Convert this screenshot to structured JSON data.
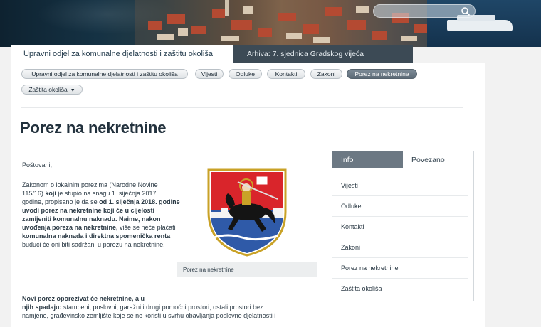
{
  "search": {
    "placeholder": ""
  },
  "header": {
    "title": "Upravni odjel za komunalne djelatnosti i zaštitu okoliša",
    "archive": "Arhiva: 7. sjednica Gradskog vijeća"
  },
  "nav": {
    "tabs": [
      {
        "label": "Upravni odjel za komunalne djelatnosti i zaštitu okoliša",
        "active": false
      },
      {
        "label": "Vijesti",
        "active": false
      },
      {
        "label": "Odluke",
        "active": false
      },
      {
        "label": "Kontakti",
        "active": false
      },
      {
        "label": "Zakoni",
        "active": false
      },
      {
        "label": "Porez na nekretnine",
        "active": true
      }
    ],
    "dropdown": {
      "label": "Zaštita okoliša",
      "caret": "▼"
    }
  },
  "page": {
    "title": "Porez na nekretnine",
    "greeting": "Poštovani,",
    "p1_a": "Zakonom o lokalnim porezima (Narodne Novine 115/16)",
    "p1_b": " koji",
    "p1_c": " je stupio na snagu 1. siječnja 2017. godine, propisano je da se ",
    "p1_d": "od 1. siječnja 2018. godine uvodi porez na nekretnine koji će u cijelosti zamijeniti komunalnu naknadu. Naime, nakon uvođenja poreza na nekretnine,",
    "p1_e": " više se neće plaćati ",
    "p1_f": "komunalna naknada i direktna spomenička renta",
    "p1_g": " budući će oni biti sadržani u porezu na nekretnine.",
    "p2_line1": "Novi porez oporezivat će nekretnine, a u",
    "p2_line2_bold": "njih spadaju:",
    "p2_line2_rest": " stambeni, poslovni, garažni i drugi pomoćni prostori, ostali prostori bez",
    "p2_line3": "namjene, građevinsko zemljište koje se ne koristi u svrhu obavljanja poslovne djelatnosti i",
    "image_caption": "Porez na nekretnine"
  },
  "sidebar": {
    "tabs": [
      {
        "label": "Info",
        "active": true
      },
      {
        "label": "Povezano",
        "active": false
      }
    ],
    "items": [
      "Vijesti",
      "Odluke",
      "Kontakti",
      "Zakoni",
      "Porez na nekretnine",
      "Zaštita okoliša"
    ]
  },
  "colors": {
    "accent_dark": "#3c4a55",
    "active_tab": "#6c7883",
    "coat_red": "#d9252b",
    "coat_blue": "#2f5aa8"
  }
}
